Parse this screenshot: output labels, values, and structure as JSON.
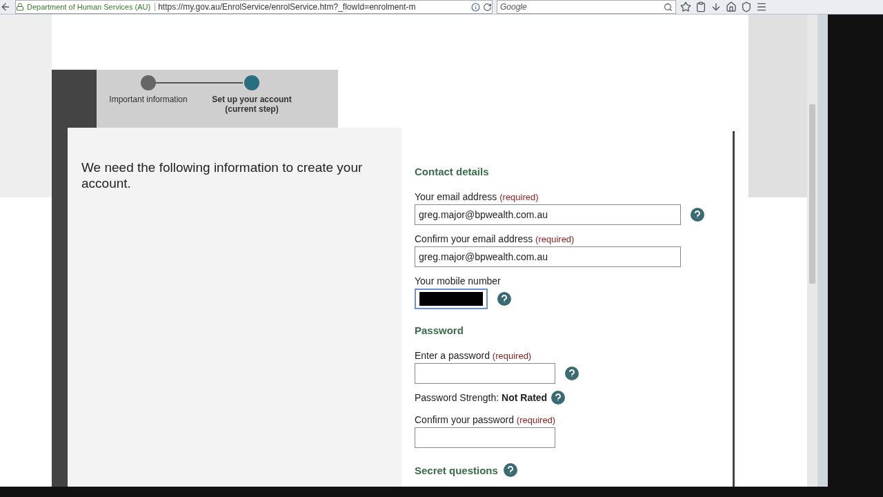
{
  "browser": {
    "site_identity": "Department of Human Services (AU)",
    "url": "https://my.gov.au/EnrolService/enrolService.htm?_flowId=enrolment-m",
    "search_placeholder": "Google"
  },
  "steps": [
    {
      "label": "Important information",
      "selected": false
    },
    {
      "label": "Set up your account (current step)",
      "selected": true
    }
  ],
  "intro": "We need the following information to create your account.",
  "sections": [
    {
      "title": "Contact details",
      "help": false,
      "items": [
        {
          "kind": "email",
          "label": "Your email address",
          "note": "(required)",
          "value": "greg.major@bpwealth.com.au",
          "help": true,
          "focused": false
        },
        {
          "kind": "email",
          "label": "Confirm your email address",
          "note": "(required)",
          "value": "greg.major@bpwealth.com.au",
          "help": false,
          "focused": false
        },
        {
          "kind": "phone",
          "label": "Your mobile number",
          "help": true,
          "focused": true
        }
      ]
    },
    {
      "title": "Password",
      "help": false,
      "items": [
        {
          "kind": "password",
          "label": "Enter a password",
          "note": "(required)",
          "help": true,
          "focused": false
        },
        {
          "kind": "strength",
          "label": "Password Strength:",
          "value": "Not Rated",
          "help": true
        },
        {
          "kind": "password",
          "label": "Confirm your password",
          "note": "(required)",
          "help": false,
          "focused": false
        }
      ]
    },
    {
      "title": "Secret questions",
      "help": true
    }
  ]
}
